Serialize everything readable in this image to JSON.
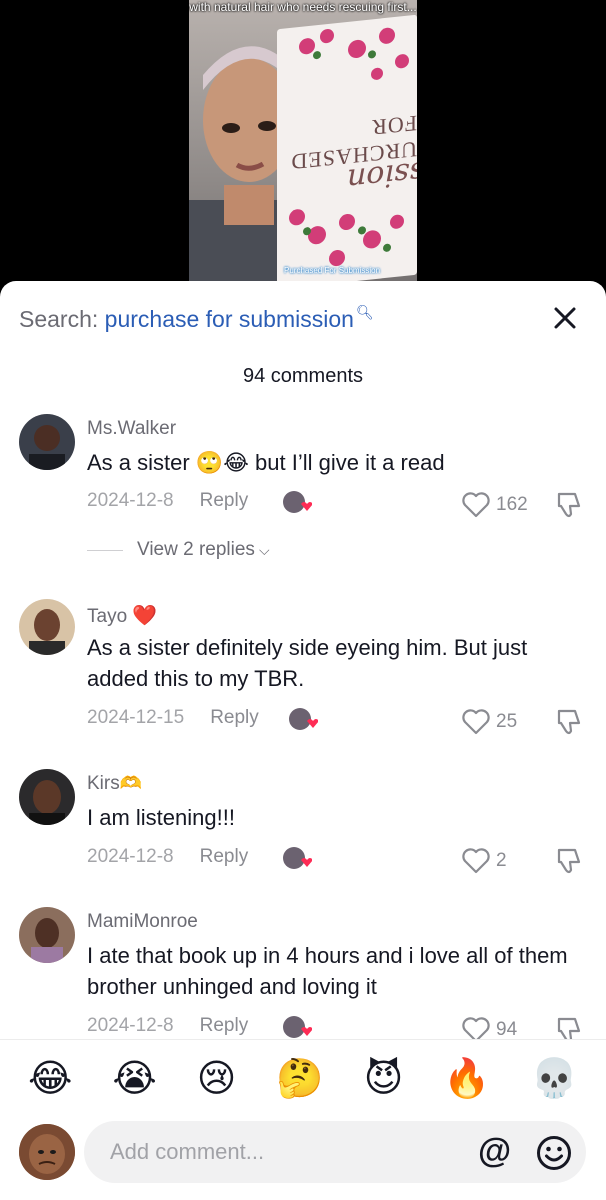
{
  "video": {
    "caption": "with natural hair who needs rescuing first...",
    "book_title": "URCHASED FOR",
    "book_subtitle": "Submission",
    "tag": "Purchased For Submission"
  },
  "sheet": {
    "search_prefix": "Search:",
    "search_term": "purchase for submission",
    "comment_count": "94 comments"
  },
  "comments": [
    {
      "username": "Ms.Walker",
      "text": "As a sister 🙄😂 but I’ll give it a read",
      "date": "2024-12-8",
      "reply": "Reply",
      "likes": "162",
      "view_replies": "View 2 replies"
    },
    {
      "username": "Tayo",
      "username_emoji": "❤️",
      "text": "As a sister definitely side eyeing him. But just added this to my TBR.",
      "date": "2024-12-15",
      "reply": "Reply",
      "likes": "25"
    },
    {
      "username": "Kirs",
      "username_emoji": "🫶",
      "text": "I am listening!!!",
      "date": "2024-12-8",
      "reply": "Reply",
      "likes": "2"
    },
    {
      "username": "MamiMonroe",
      "text": "I ate that book up in 4 hours and i love all of them brother unhinged and loving it",
      "date": "2024-12-8",
      "reply": "Reply",
      "likes": "94"
    }
  ],
  "quick_emojis": [
    "😂",
    "😭",
    "😢",
    "🤔",
    "😈",
    "🔥",
    "💀"
  ],
  "composer": {
    "placeholder": "Add comment...",
    "at_symbol": "@"
  },
  "colors": {
    "link_blue": "#2b5db5",
    "muted_text": "#8a8b91",
    "heart_red": "#fe2c55"
  }
}
